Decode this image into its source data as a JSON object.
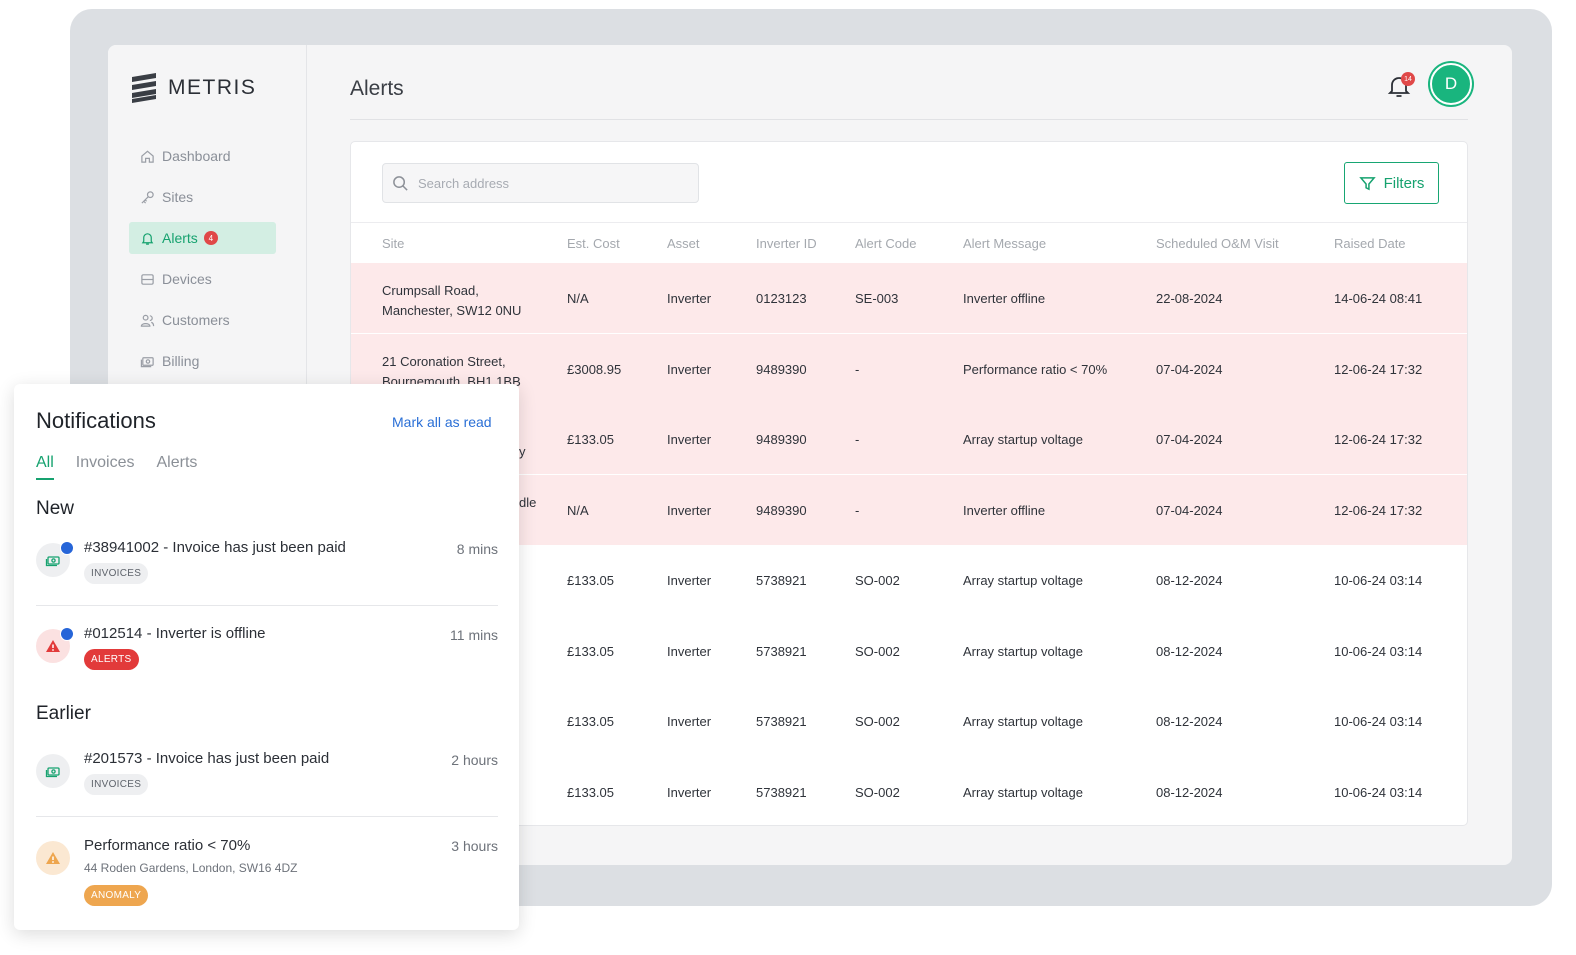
{
  "app": {
    "brand": "METRIS",
    "page_title": "Alerts",
    "bell_count": "14",
    "avatar_initial": "D"
  },
  "sidebar": {
    "items": [
      {
        "label": "Dashboard",
        "icon": "home-icon"
      },
      {
        "label": "Sites",
        "icon": "key-icon"
      },
      {
        "label": "Alerts",
        "icon": "bell-icon",
        "badge": "4",
        "active": true
      },
      {
        "label": "Devices",
        "icon": "device-icon"
      },
      {
        "label": "Customers",
        "icon": "users-icon"
      },
      {
        "label": "Billing",
        "icon": "billing-icon"
      }
    ]
  },
  "toolbar": {
    "search_placeholder": "Search address",
    "filters_label": "Filters"
  },
  "table": {
    "headers": [
      "Site",
      "Est. Cost",
      "Asset",
      "Inverter ID",
      "Alert Code",
      "Alert Message",
      "Scheduled O&M Visit",
      "Raised Date"
    ],
    "rows": [
      {
        "site1": "Crumpsall Road,",
        "site2": "Manchester, SW12 0NU",
        "cost": "N/A",
        "asset": "Inverter",
        "inverter_id": "0123123",
        "code": "SE-003",
        "message": "Inverter offline",
        "visit": "22-08-2024",
        "raised": "14-06-24 08:41",
        "highlight": true
      },
      {
        "site1": "21 Coronation Street,",
        "site2": "Bournemouth, BH1 1BB",
        "cost": "£3008.95",
        "asset": "Inverter",
        "inverter_id": "9489390",
        "code": "-",
        "message": "Performance ratio < 70%",
        "visit": "07-04-2024",
        "raised": "12-06-24 17:32",
        "highlight": true
      },
      {
        "site1": "",
        "site2": "y",
        "cost": "£133.05",
        "asset": "Inverter",
        "inverter_id": "9489390",
        "code": "-",
        "message": "Array startup voltage",
        "visit": "07-04-2024",
        "raised": "12-06-24 17:32",
        "highlight": true
      },
      {
        "site1": "dle",
        "site2": "",
        "cost": "N/A",
        "asset": "Inverter",
        "inverter_id": "9489390",
        "code": "-",
        "message": "Inverter offline",
        "visit": "07-04-2024",
        "raised": "12-06-24 17:32",
        "highlight": true
      },
      {
        "site1": "",
        "site2": "",
        "cost": "£133.05",
        "asset": "Inverter",
        "inverter_id": "5738921",
        "code": "SO-002",
        "message": "Array startup voltage",
        "visit": "08-12-2024",
        "raised": "10-06-24 03:14",
        "highlight": false
      },
      {
        "site1": "",
        "site2": "",
        "cost": "£133.05",
        "asset": "Inverter",
        "inverter_id": "5738921",
        "code": "SO-002",
        "message": "Array startup voltage",
        "visit": "08-12-2024",
        "raised": "10-06-24 03:14",
        "highlight": false
      },
      {
        "site1": "",
        "site2": "",
        "cost": "£133.05",
        "asset": "Inverter",
        "inverter_id": "5738921",
        "code": "SO-002",
        "message": "Array startup voltage",
        "visit": "08-12-2024",
        "raised": "10-06-24 03:14",
        "highlight": false
      },
      {
        "site1": "",
        "site2": "",
        "cost": "£133.05",
        "asset": "Inverter",
        "inverter_id": "5738921",
        "code": "SO-002",
        "message": "Array startup voltage",
        "visit": "08-12-2024",
        "raised": "10-06-24 03:14",
        "highlight": false
      }
    ]
  },
  "notifications": {
    "title": "Notifications",
    "mark_all": "Mark all as read",
    "tabs": [
      "All",
      "Invoices",
      "Alerts"
    ],
    "active_tab": "All",
    "section_new": "New",
    "section_earlier": "Earlier",
    "items": [
      {
        "text": "#38941002 - Invoice has just been paid",
        "time": "8 mins",
        "chip": "INVOICES",
        "icon": "cash-icon",
        "unread": true
      },
      {
        "text": "#012514 - Inverter is offline",
        "time": "11 mins",
        "chip": "ALERTS",
        "icon": "warning-icon",
        "unread": true
      },
      {
        "text": "#201573 - Invoice has just been paid",
        "time": "2 hours",
        "chip": "INVOICES",
        "icon": "cash-icon",
        "unread": false
      },
      {
        "text": "Performance ratio < 70%",
        "sub": "44 Roden Gardens, London, SW16 4DZ",
        "time": "3 hours",
        "chip": "ANOMALY",
        "icon": "warning-icon",
        "unread": false
      }
    ]
  },
  "colors": {
    "accent": "#16a26f",
    "alert_row": "#fde9ea",
    "danger": "#e23a3a",
    "anomaly": "#eea64f",
    "link": "#2a6fd6",
    "unread_dot": "#2665d8"
  }
}
